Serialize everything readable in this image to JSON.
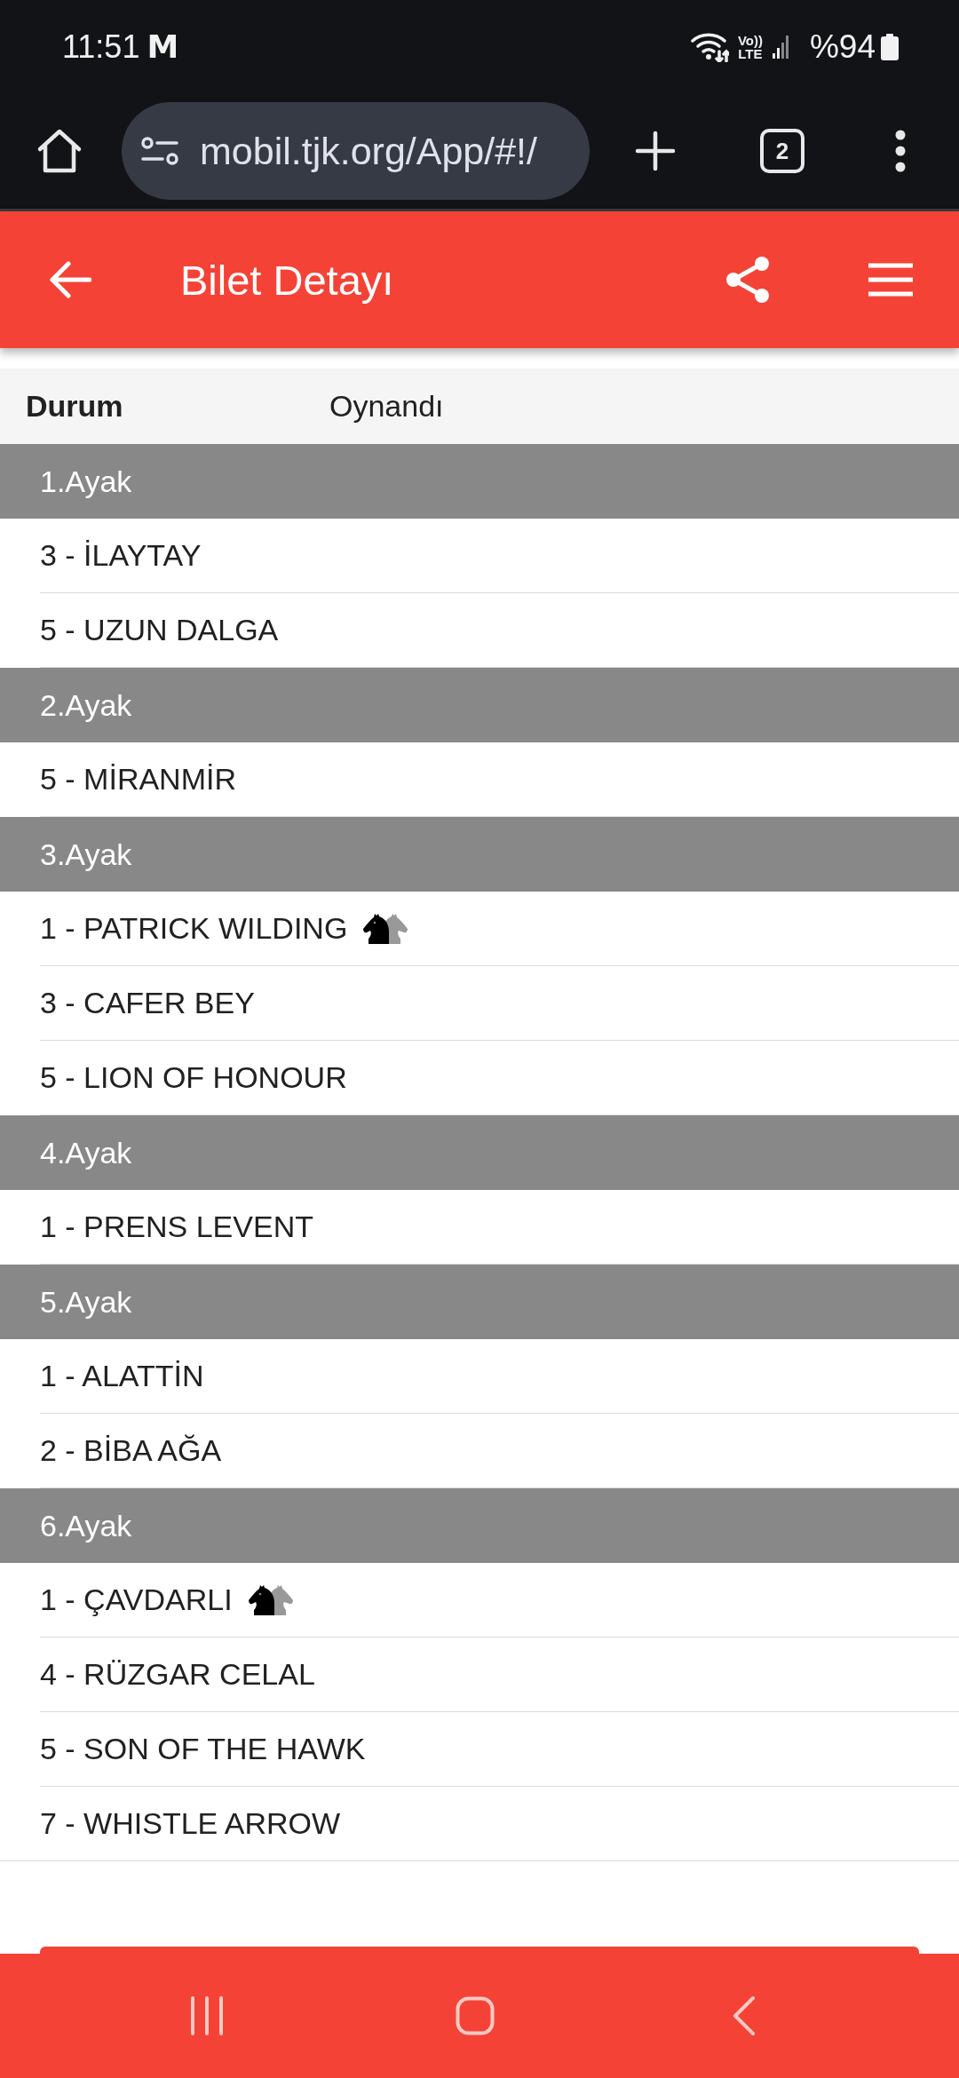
{
  "status_bar": {
    "time": "11:51",
    "notification_icon": "M",
    "volte_top": "Vo))",
    "volte_bottom": "LTE",
    "battery": "%94"
  },
  "browser": {
    "url": "mobil.tjk.org/App/#!/",
    "tab_count": "2"
  },
  "header": {
    "title": "Bilet Detayı"
  },
  "status_row": {
    "label": "Durum",
    "value": "Oynandı"
  },
  "legs": [
    {
      "title": "1.Ayak",
      "horses": [
        {
          "name": "3 - İLAYTAY",
          "horse_icon": false
        },
        {
          "name": "5 - UZUN DALGA",
          "horse_icon": false
        }
      ]
    },
    {
      "title": "2.Ayak",
      "horses": [
        {
          "name": "5 - MİRANMİR",
          "horse_icon": false
        }
      ]
    },
    {
      "title": "3.Ayak",
      "horses": [
        {
          "name": "1 - PATRICK WILDING",
          "horse_icon": true
        },
        {
          "name": "3 - CAFER BEY",
          "horse_icon": false
        },
        {
          "name": "5 - LION OF HONOUR",
          "horse_icon": false
        }
      ]
    },
    {
      "title": "4.Ayak",
      "horses": [
        {
          "name": "1 - PRENS LEVENT",
          "horse_icon": false
        }
      ]
    },
    {
      "title": "5.Ayak",
      "horses": [
        {
          "name": "1 - ALATTİN",
          "horse_icon": false
        },
        {
          "name": "2 - BİBA AĞA",
          "horse_icon": false
        }
      ]
    },
    {
      "title": "6.Ayak",
      "horses": [
        {
          "name": "1 - ÇAVDARLI",
          "horse_icon": true
        },
        {
          "name": "4 - RÜZGAR CELAL",
          "horse_icon": false
        },
        {
          "name": "5 - SON OF THE HAWK",
          "horse_icon": false
        },
        {
          "name": "7 - WHISTLE ARROW",
          "horse_icon": false
        }
      ]
    }
  ]
}
